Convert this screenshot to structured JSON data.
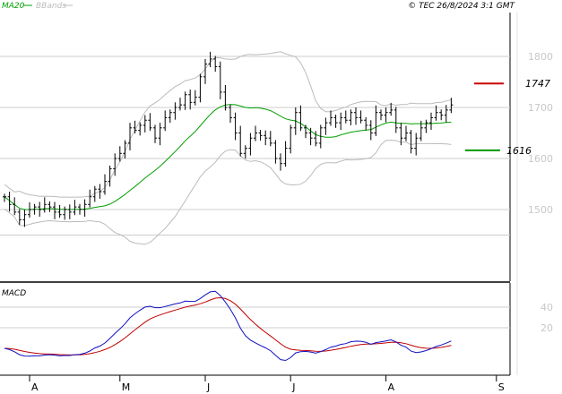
{
  "header": {
    "legend_ma20": "MA20",
    "legend_bbands": "BBands",
    "copyright": "© TEC 26/8/2024 3:1 GMT"
  },
  "macd_panel": {
    "label": "MACD"
  },
  "colors": {
    "bars": "#000000",
    "ma20": "#00a000",
    "bbands": "#bbbbbb",
    "resistance": "#cc0000",
    "support": "#009900",
    "macd": "#1010c0",
    "signal": "#c00000",
    "grid": "#cccccc"
  },
  "chart_data": [
    {
      "type": "ohlc",
      "y_ticks": [
        {
          "value": 1800,
          "label": "1800"
        },
        {
          "value": 1700,
          "label": "1700"
        },
        {
          "value": 1600,
          "label": "1600"
        },
        {
          "value": 1500,
          "label": "1500"
        }
      ],
      "x_ticks": [
        {
          "index": 5,
          "label": "A"
        },
        {
          "index": 23,
          "label": "M"
        },
        {
          "index": 40,
          "label": "J"
        },
        {
          "index": 57,
          "label": "J"
        },
        {
          "index": 76,
          "label": "A"
        },
        {
          "index": 98,
          "label": "S"
        }
      ],
      "levels": [
        {
          "name": "resistance",
          "value": 1747,
          "label": "1747"
        },
        {
          "name": "support",
          "value": 1616,
          "label": "1616"
        }
      ],
      "closes": [
        1525,
        1510,
        1495,
        1480,
        1490,
        1500,
        1505,
        1500,
        1510,
        1505,
        1495,
        1490,
        1500,
        1495,
        1505,
        1500,
        1510,
        1525,
        1540,
        1535,
        1555,
        1580,
        1600,
        1610,
        1630,
        1660,
        1655,
        1665,
        1675,
        1660,
        1640,
        1660,
        1680,
        1690,
        1700,
        1705,
        1725,
        1710,
        1720,
        1760,
        1785,
        1795,
        1780,
        1730,
        1700,
        1680,
        1650,
        1610,
        1620,
        1640,
        1650,
        1645,
        1640,
        1630,
        1600,
        1590,
        1620,
        1660,
        1690,
        1660,
        1650,
        1640,
        1630,
        1660,
        1670,
        1680,
        1670,
        1680,
        1675,
        1690,
        1680,
        1675,
        1665,
        1650,
        1690,
        1685,
        1690,
        1695,
        1660,
        1640,
        1650,
        1620,
        1640,
        1660,
        1670,
        1680,
        1690,
        1685,
        1695,
        1705
      ]
    },
    {
      "type": "line",
      "title": "MACD",
      "y_ticks": [
        {
          "value": 40,
          "label": "40"
        },
        {
          "value": 20,
          "label": "20"
        }
      ]
    }
  ]
}
